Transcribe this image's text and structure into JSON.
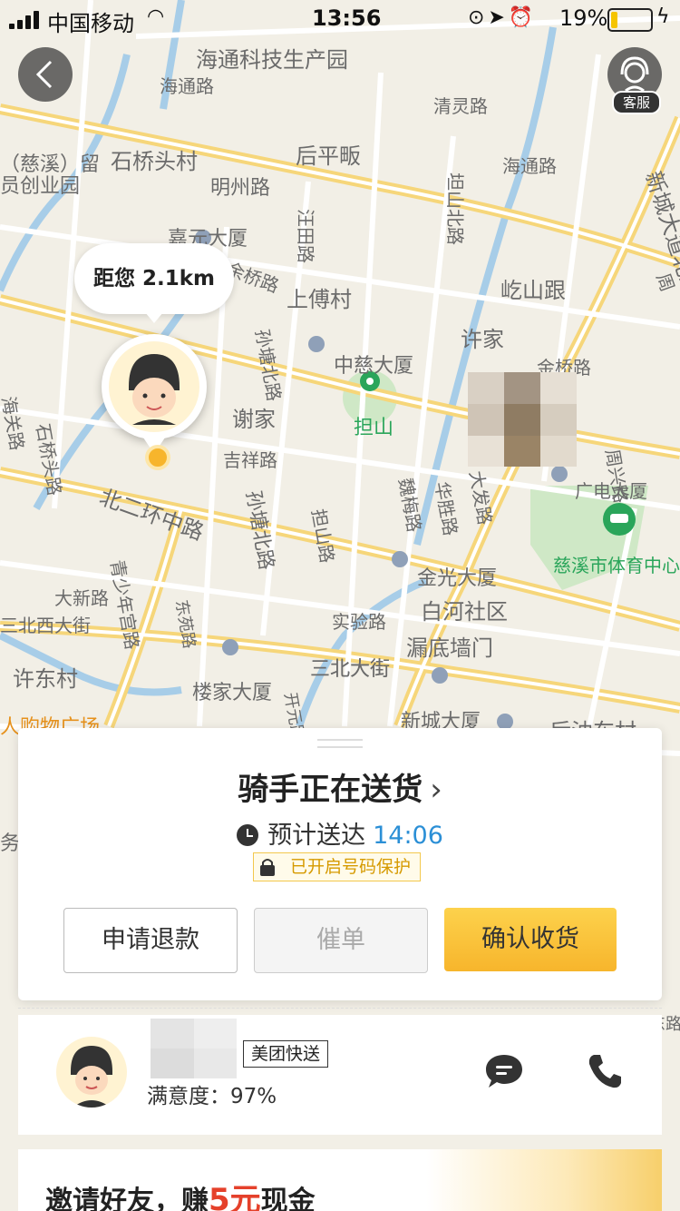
{
  "status_bar": {
    "carrier": "中国移动",
    "time": "13:56",
    "battery_percent_label": "19%",
    "battery_level": 0.19
  },
  "nav": {
    "service_label": "客服"
  },
  "map": {
    "distance_label": "距您 2.1km",
    "places": [
      "海通科技生产园",
      "海通路",
      "清灵路",
      "后平畈",
      "石桥头村",
      "（慈溪）留",
      "员创业园",
      "明州路",
      "海通路",
      "嘉元大厦",
      "汪田路",
      "坦山北路",
      "屹山跟",
      "新城大道北路",
      "周",
      "余桥路",
      "上傅村",
      "许家",
      "金桥路",
      "中慈大厦",
      "孙塘北路",
      "谢家",
      "担山",
      "吉祥路",
      "周兴路",
      "北二环中路",
      "石桥头路",
      "海关路",
      "广电大厦",
      "大发路",
      "魏梅路",
      "华胜路",
      "慈溪市体育中心",
      "担山路",
      "孙塘北路",
      "金光大厦",
      "白河社区",
      "大新路",
      "青少年宫路",
      "东苑路",
      "三北西大街",
      "实验路",
      "漏底墙门",
      "许东村",
      "楼家大厦",
      "三北大街",
      "开元路",
      "三北大街",
      "新城大厦",
      "后油车村",
      "人购物广场",
      "务",
      "东路"
    ]
  },
  "order_panel": {
    "status_title": "骑手正在送货",
    "chevron": "›",
    "eta_label": "预计送达",
    "eta_time": "14:06",
    "privacy_label": "已开启号码保护",
    "buttons": {
      "refund": "申请退款",
      "urge": "催单",
      "confirm": "确认收货"
    }
  },
  "rider": {
    "tag": "美团快送",
    "rating": "满意度：97%"
  },
  "invite_banner": {
    "text_before": "邀请好友，赚",
    "amount": "5元",
    "text_after": "现金"
  },
  "colors": {
    "accent_yellow": "#f7b52c",
    "eta_blue": "#2b8fd6",
    "park_green": "#2aa55a",
    "invite_red": "#e5412b"
  },
  "icons": [
    "back-arrow-icon",
    "customer-service-icon",
    "clock-icon",
    "lock-icon",
    "chat-icon",
    "phone-icon",
    "location-pin-icon",
    "building-icon",
    "stadium-icon"
  ]
}
